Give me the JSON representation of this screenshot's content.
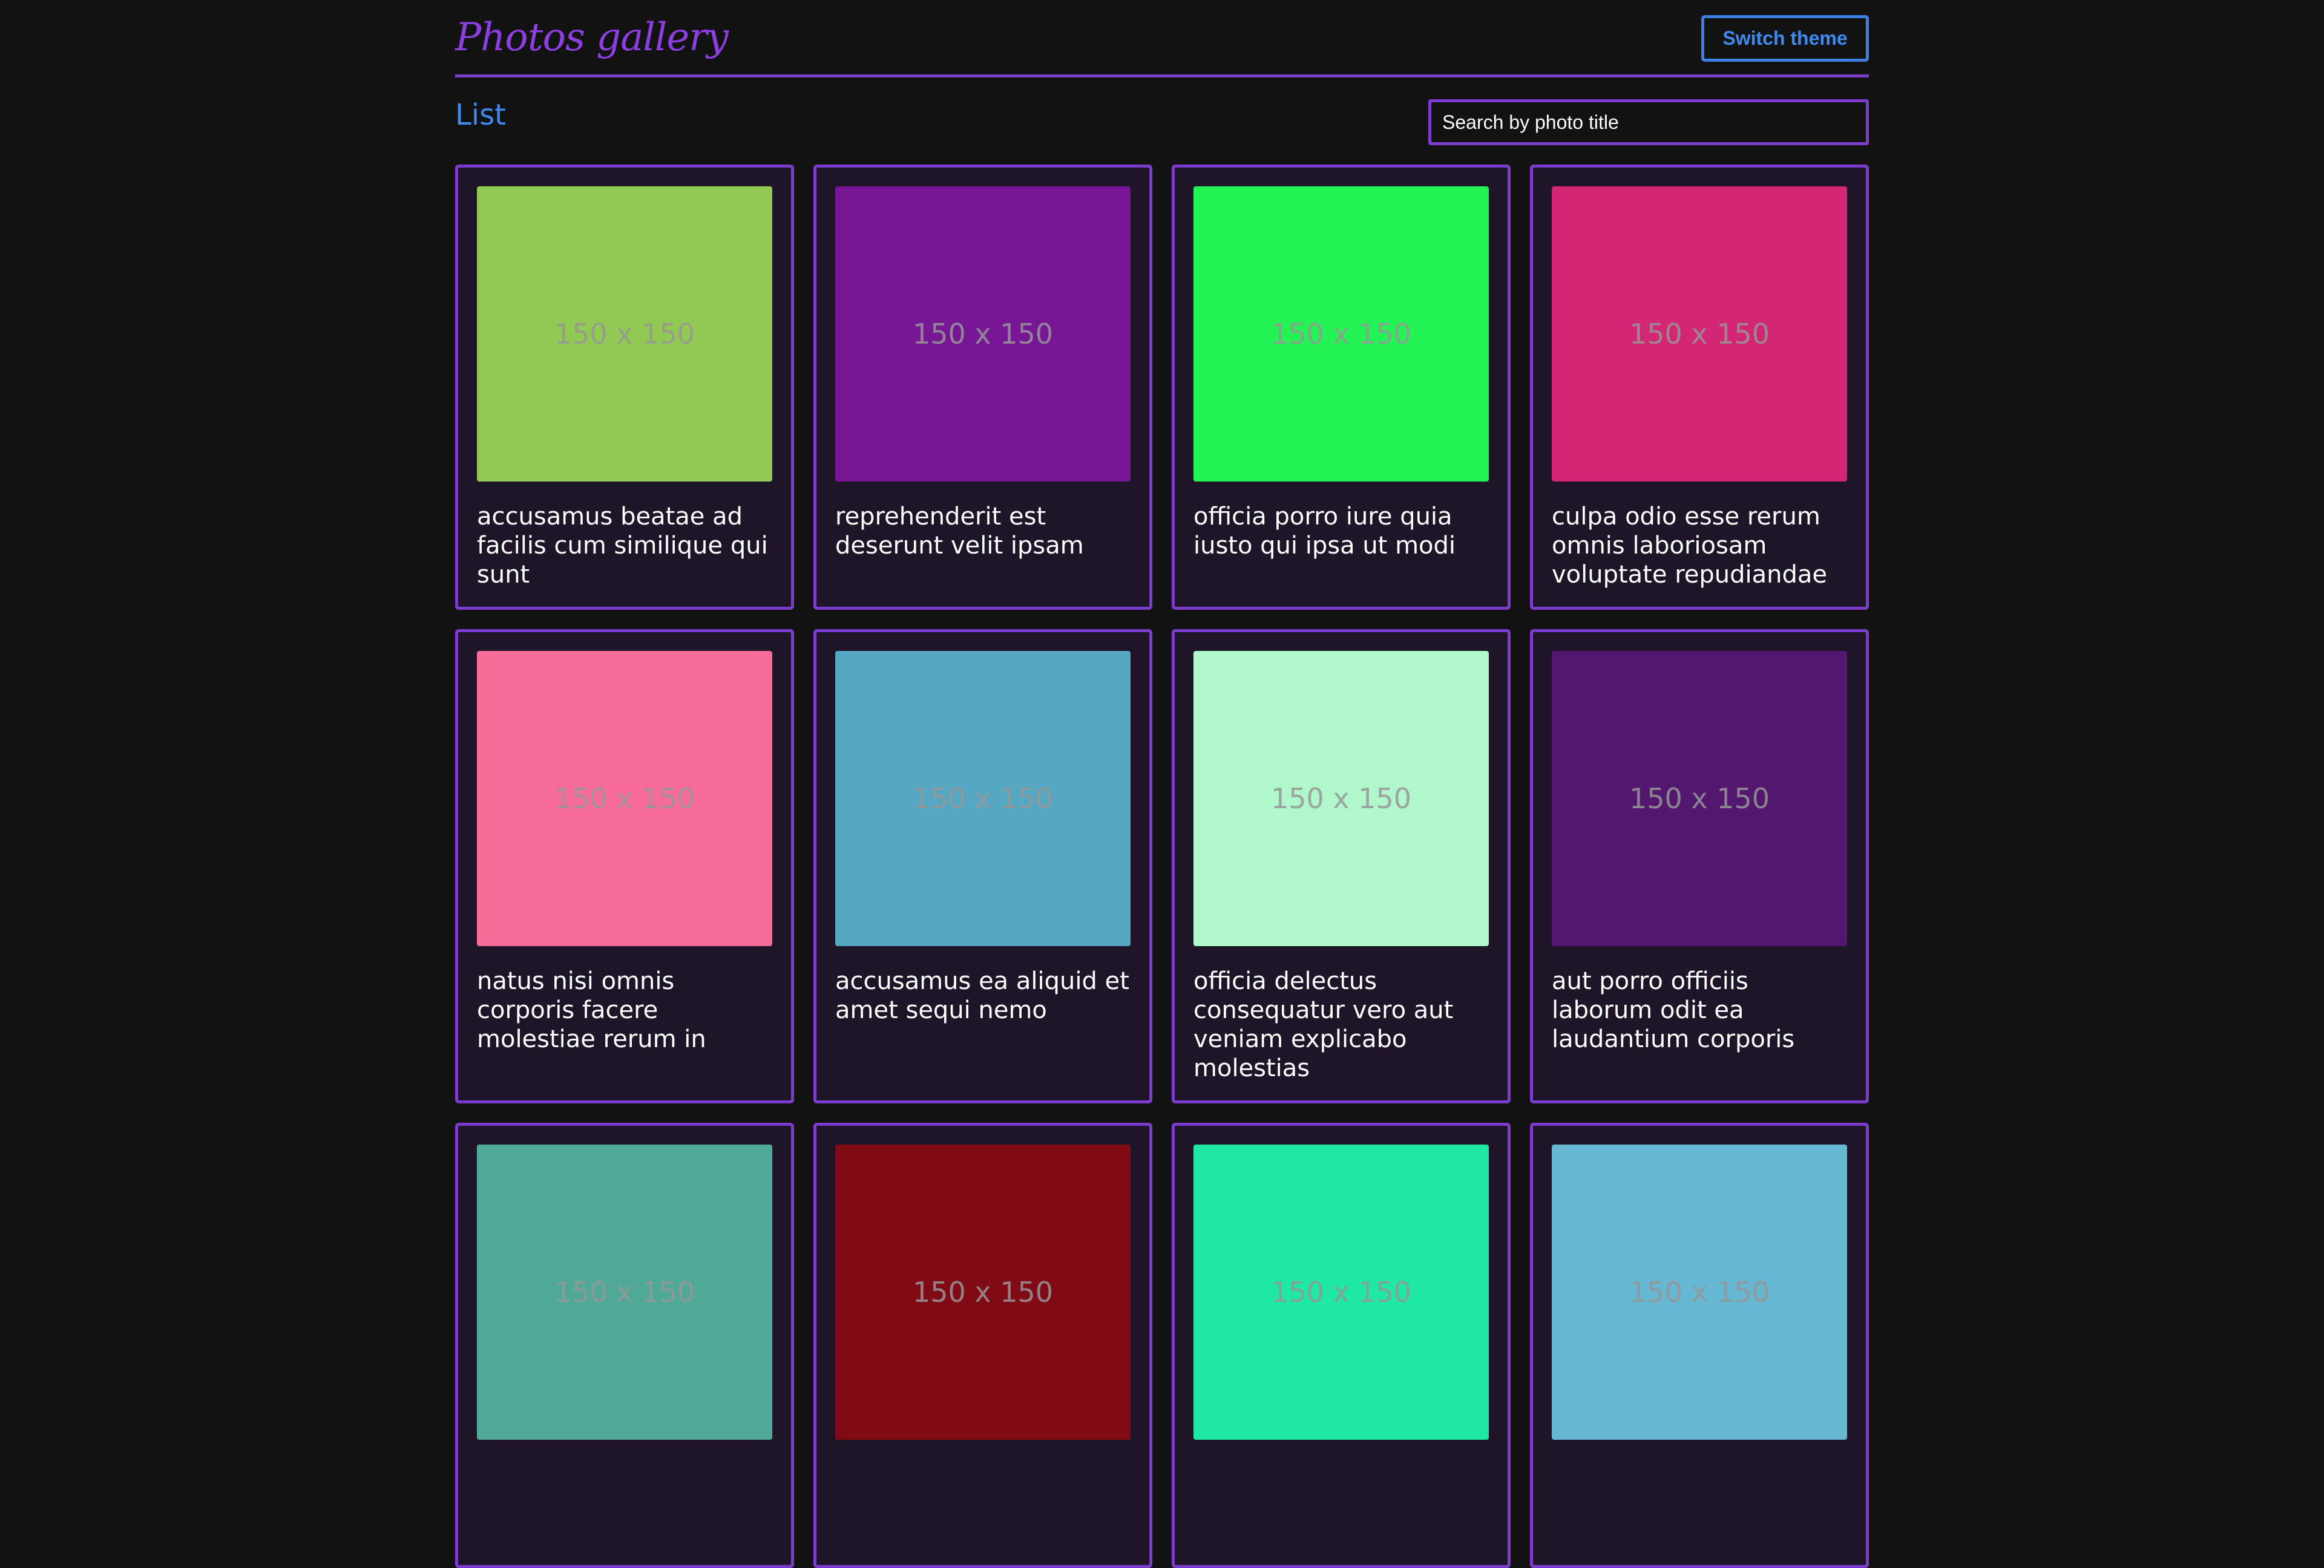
{
  "header": {
    "logo": "Photos gallery",
    "switch_theme": "Switch theme"
  },
  "main": {
    "title": "List",
    "search_placeholder": "Search by photo title"
  },
  "photos": [
    {
      "title": "accusamus beatae ad facilis cum similique qui sunt",
      "color": "#92c952",
      "label": "150 x 150"
    },
    {
      "title": "reprehenderit est deserunt velit ipsam",
      "color": "#771796",
      "label": "150 x 150"
    },
    {
      "title": "officia porro iure quia iusto qui ipsa ut modi",
      "color": "#24f355",
      "label": "150 x 150"
    },
    {
      "title": "culpa odio esse rerum omnis laboriosam voluptate repudiandae",
      "color": "#d32776",
      "label": "150 x 150"
    },
    {
      "title": "natus nisi omnis corporis facere molestiae rerum in",
      "color": "#f66b97",
      "label": "150 x 150"
    },
    {
      "title": "accusamus ea aliquid et amet sequi nemo",
      "color": "#56a8c2",
      "label": "150 x 150"
    },
    {
      "title": "officia delectus consequatur vero aut veniam explicabo molestias",
      "color": "#b0f7cc",
      "label": "150 x 150"
    },
    {
      "title": "aut porro officiis laborum odit ea laudantium corporis",
      "color": "#54176f",
      "label": "150 x 150"
    },
    {
      "title": "",
      "color": "#51aa97",
      "label": "150 x 150"
    },
    {
      "title": "",
      "color": "#810b14",
      "label": "150 x 150"
    },
    {
      "title": "",
      "color": "#1ee8a4",
      "label": "150 x 150"
    },
    {
      "title": "",
      "color": "#66b7d2",
      "label": "150 x 150"
    }
  ]
}
